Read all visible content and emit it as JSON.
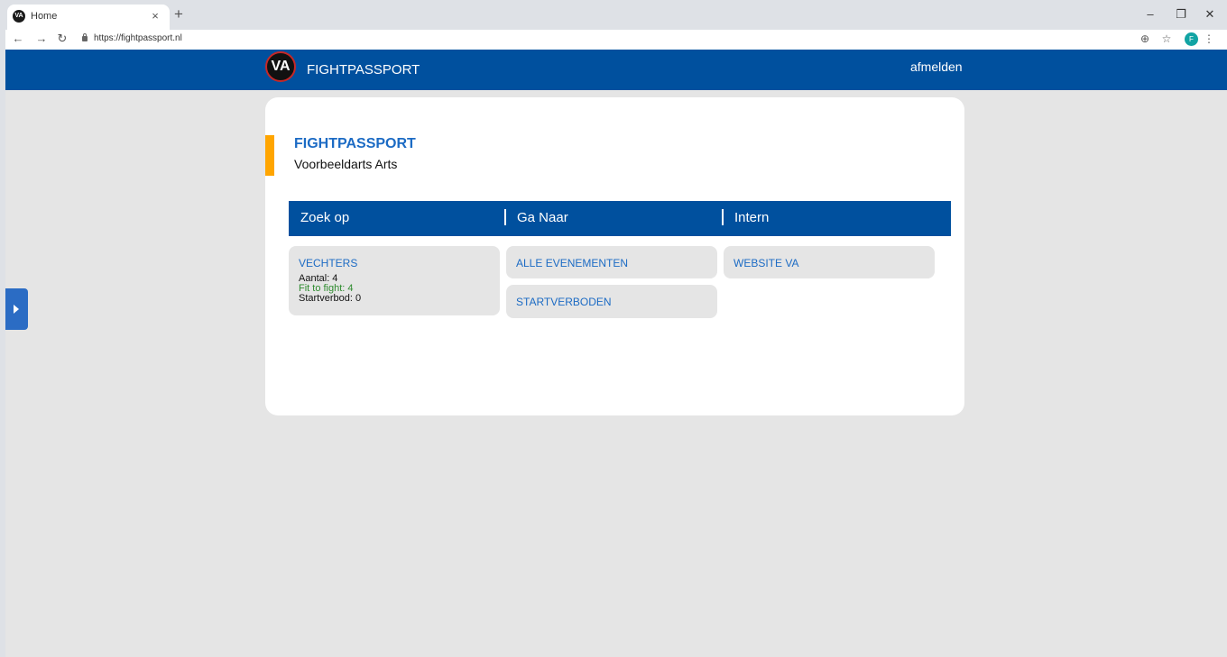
{
  "browser": {
    "tab_title": "Home",
    "tab_favicon": "VA",
    "close_glyph": "×",
    "new_tab_glyph": "+",
    "url": "https://fightpassport.nl",
    "profile_initial": "F"
  },
  "header": {
    "logo_text": "VA",
    "brand": "FIGHTPASSPORT",
    "logout": "afmelden"
  },
  "card": {
    "title": "FIGHTPASSPORT",
    "subtitle": "Voorbeeldarts Arts",
    "accent_color": "#ffa500"
  },
  "menu": {
    "columns": [
      "Zoek op",
      "Ga Naar",
      "Intern"
    ]
  },
  "tiles": {
    "vechters": {
      "label": "VECHTERS",
      "aantal": "Aantal: 4",
      "fit": "Fit to fight: 4",
      "startverbod": "Startverbod: 0"
    },
    "alle_evenementen": "ALLE EVENEMENTEN",
    "startverboden": "STARTVERBODEN",
    "website_va": "WEBSITE VA"
  },
  "colors": {
    "brand_blue": "#00509e",
    "link_blue": "#1c6bc4",
    "fit_green": "#2e8b2e",
    "page_bg": "#e5e5e5"
  }
}
